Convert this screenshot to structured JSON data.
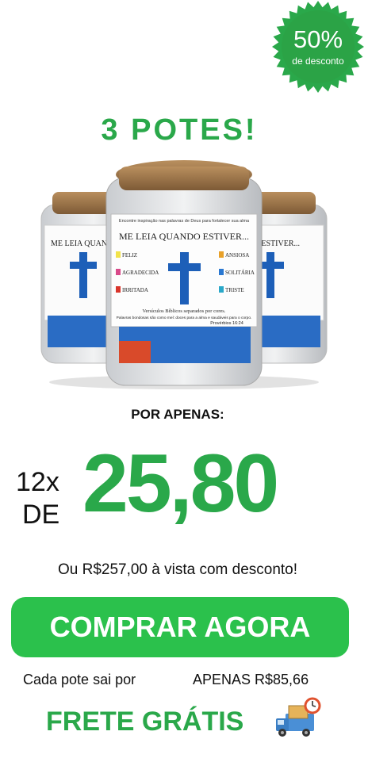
{
  "badge": {
    "percent": "50%",
    "subtitle": "de desconto",
    "color": "#2aa84a"
  },
  "headline": "3 POTES!",
  "product": {
    "jar_header": "Encontre inspiração nas palavras de Deus para fortalecer sua alma",
    "jar_title": "ME LEIA QUANDO ESTIVER...",
    "moods_left": [
      "FELIZ",
      "AGRADECIDA",
      "IRRITADA"
    ],
    "moods_right": [
      "ANSIOSA",
      "SOLITÁRIA",
      "TRISTE"
    ],
    "jar_footer": "Versículos Bíblicos separados por cores.",
    "jar_quote": "Palavras bondosas são como mel: doces para a alma e saudáveis para o corpo.",
    "jar_ref": "Provérbios 16:24",
    "mood_colors": [
      "#f2e34a",
      "#d94a8a",
      "#d9352b",
      "#e8a12a",
      "#2a78d1",
      "#2aa8c9"
    ]
  },
  "offer": {
    "por_apenas": "POR APENAS:",
    "installments": "12x",
    "de": "DE",
    "price": "25,80",
    "avista": "Ou R$257,00 à vista com desconto!",
    "cta": "COMPRAR AGORA",
    "cada_pote": "Cada pote sai por",
    "per_pot": "APENAS R$85,66",
    "frete": "FRETE GRÁTIS"
  },
  "colors": {
    "brand_green": "#2aa84a",
    "button_green": "#2bc14c"
  }
}
